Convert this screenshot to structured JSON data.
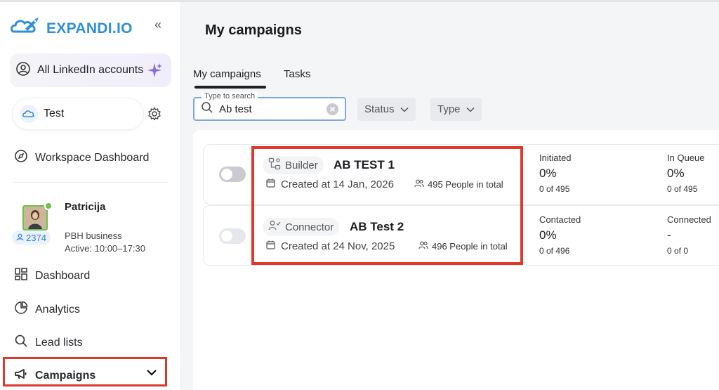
{
  "app": {
    "logo_text": "EXPANDI.IO"
  },
  "sidebar": {
    "all_accounts_label": "All LinkedIn accounts",
    "workspace_label": "Test",
    "workspace_dashboard_label": "Workspace Dashboard",
    "profile": {
      "name": "Patricija",
      "badge_count": "2374",
      "company": "PBH business",
      "active": "Active: 10:00–17:30"
    },
    "nav": [
      {
        "label": "Dashboard",
        "icon": "grid-icon"
      },
      {
        "label": "Analytics",
        "icon": "pie-chart-icon"
      },
      {
        "label": "Lead lists",
        "icon": "search-icon"
      },
      {
        "label": "Campaigns",
        "icon": "megaphone-icon"
      }
    ]
  },
  "main": {
    "title": "My campaigns",
    "tabs": [
      {
        "label": "My campaigns",
        "active": true
      },
      {
        "label": "Tasks",
        "active": false
      }
    ],
    "search": {
      "legend": "Type to search",
      "value": "Ab test"
    },
    "filters": [
      {
        "label": "Status"
      },
      {
        "label": "Type"
      }
    ],
    "campaigns": [
      {
        "type": "Builder",
        "name": "AB TEST 1",
        "created": "Created at 14 Jan, 2026",
        "people": "495 People in total",
        "enabled": false,
        "stats": [
          {
            "label": "Initiated",
            "pct": "0%",
            "sub": "0 of 495"
          },
          {
            "label": "In Queue",
            "pct": "0%",
            "sub": "0 of 495"
          }
        ]
      },
      {
        "type": "Connector",
        "name": "AB Test 2",
        "created": "Created at 24 Nov, 2025",
        "people": "496 People in total",
        "enabled": false,
        "stats": [
          {
            "label": "Contacted",
            "pct": "0%",
            "sub": "0 of 496"
          },
          {
            "label": "Connected",
            "pct": "-",
            "sub": "0 of 0"
          }
        ]
      }
    ]
  },
  "colors": {
    "brand": "#2f8fd8",
    "highlight": "#e0392b",
    "toggle_off_1": "#c9cbd1",
    "toggle_off_2": "#e6e7ea"
  }
}
